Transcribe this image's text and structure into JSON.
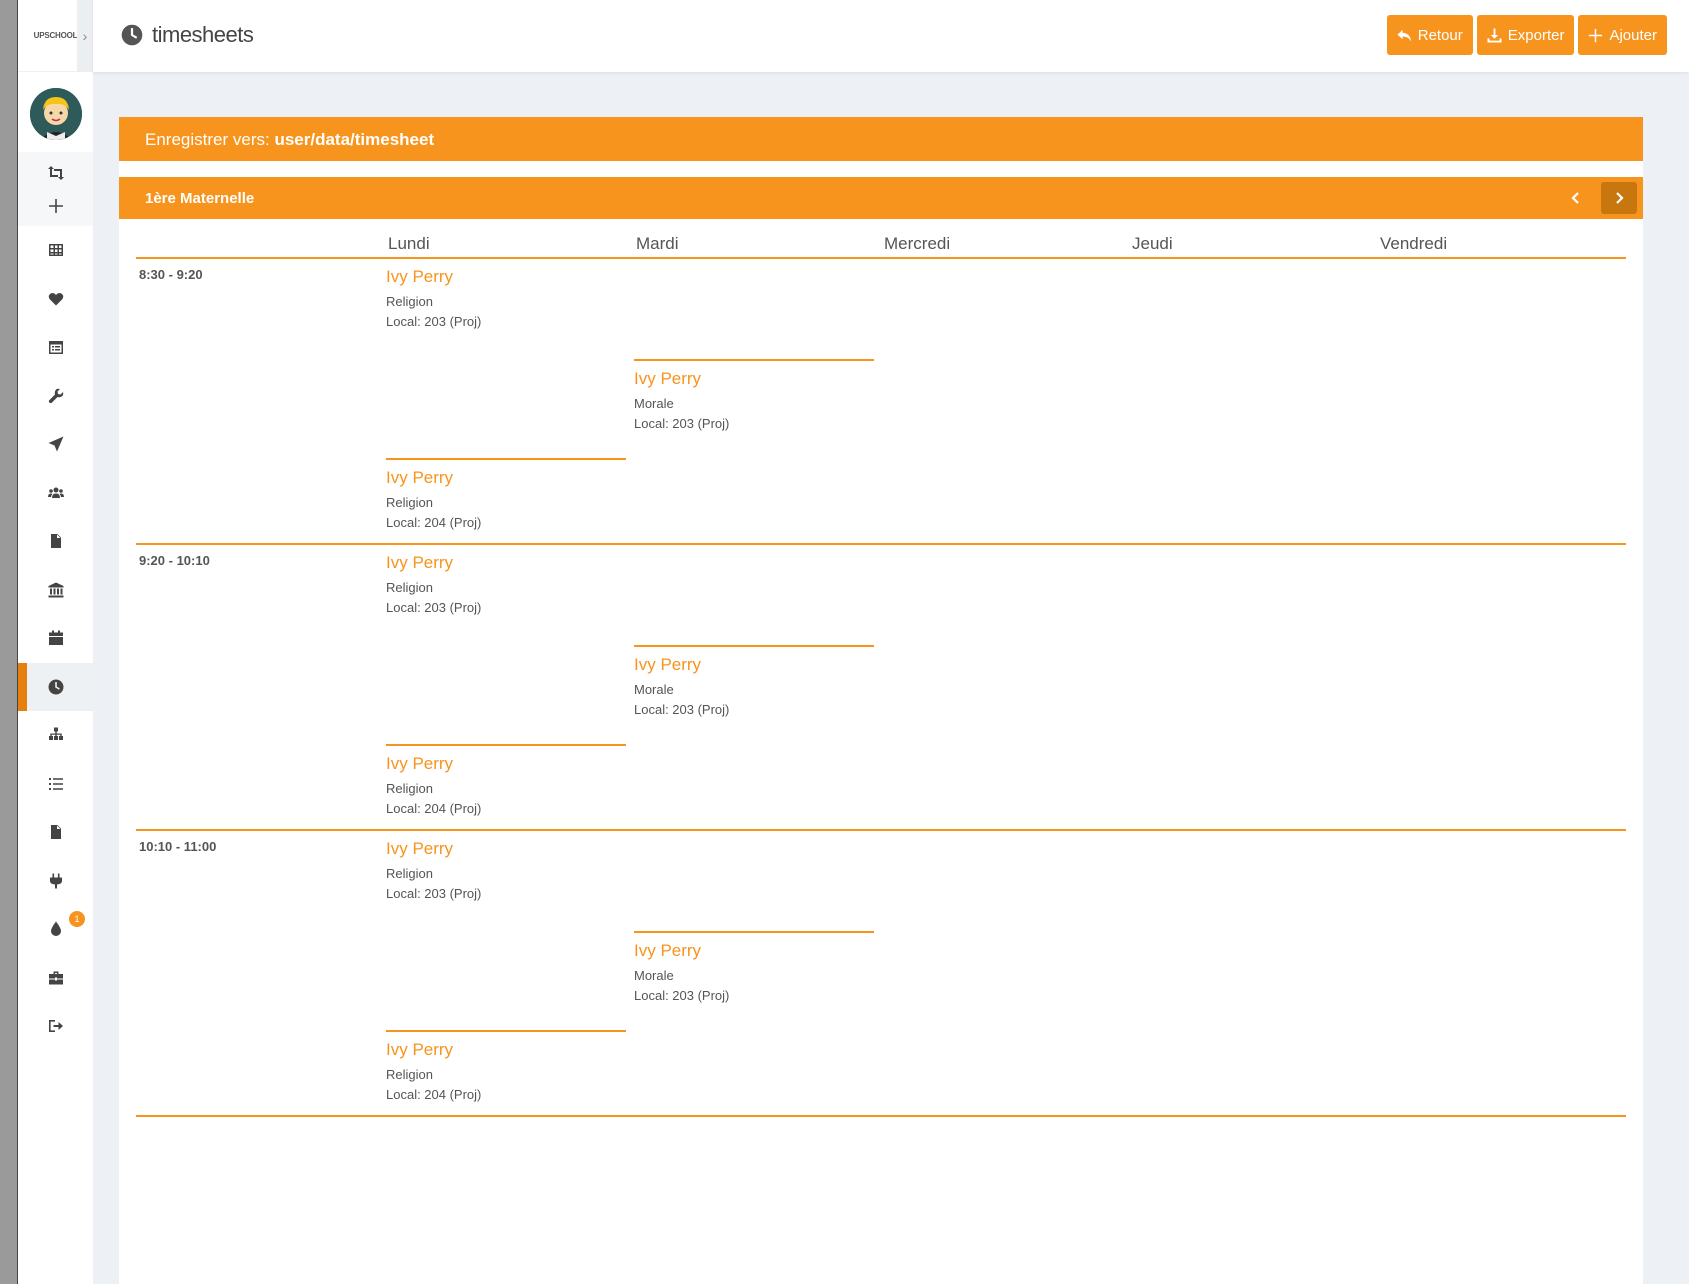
{
  "app": {
    "logo_text": "UPSCHOOL",
    "page_title": "timesheets"
  },
  "toolbar": {
    "back_label": "Retour",
    "export_label": "Exporter",
    "add_label": "Ajouter"
  },
  "save": {
    "prefix": "Enregistrer vers:",
    "path": "user/data/timesheet"
  },
  "sidebar": {
    "badge_count": "1",
    "items": [
      {
        "name": "sidebar-item-switch",
        "icon": "switch-icon"
      },
      {
        "name": "sidebar-item-add",
        "icon": "plus-icon"
      },
      {
        "name": "sidebar-item-grid",
        "icon": "table-icon"
      },
      {
        "name": "sidebar-item-favorites",
        "icon": "heart-icon"
      },
      {
        "name": "sidebar-item-calendar-list",
        "icon": "calendar-list-icon"
      },
      {
        "name": "sidebar-item-tools",
        "icon": "wrench-icon"
      },
      {
        "name": "sidebar-item-send",
        "icon": "paper-plane-icon"
      },
      {
        "name": "sidebar-item-users",
        "icon": "users-icon"
      },
      {
        "name": "sidebar-item-documents",
        "icon": "file-icon"
      },
      {
        "name": "sidebar-item-institution",
        "icon": "bank-icon"
      },
      {
        "name": "sidebar-item-calendar",
        "icon": "calendar-icon"
      },
      {
        "name": "sidebar-item-timesheets",
        "icon": "clock-icon"
      },
      {
        "name": "sidebar-item-hierarchy",
        "icon": "sitemap-icon"
      },
      {
        "name": "sidebar-item-list",
        "icon": "list-icon"
      },
      {
        "name": "sidebar-item-reports",
        "icon": "file-text-icon"
      },
      {
        "name": "sidebar-item-plugins",
        "icon": "plug-icon"
      },
      {
        "name": "sidebar-item-theme",
        "icon": "drop-icon"
      },
      {
        "name": "sidebar-item-briefcase",
        "icon": "briefcase-icon"
      },
      {
        "name": "sidebar-item-logout",
        "icon": "sign-out-icon"
      }
    ]
  },
  "timetable": {
    "class_name": "1ère Maternelle",
    "days": [
      "Lundi",
      "Mardi",
      "Mercredi",
      "Jeudi",
      "Vendredi"
    ],
    "slots": [
      {
        "time": "8:30 - 9:20",
        "entries": [
          {
            "teacher": "Ivy Perry",
            "subject": "Religion",
            "room": "Local: 203 (Proj)"
          },
          {
            "teacher": "Ivy Perry",
            "subject": "Morale",
            "room": "Local: 203 (Proj)"
          },
          {
            "teacher": "Ivy Perry",
            "subject": "Religion",
            "room": "Local: 204 (Proj)"
          }
        ]
      },
      {
        "time": "9:20 - 10:10",
        "entries": [
          {
            "teacher": "Ivy Perry",
            "subject": "Religion",
            "room": "Local: 203 (Proj)"
          },
          {
            "teacher": "Ivy Perry",
            "subject": "Morale",
            "room": "Local: 203 (Proj)"
          },
          {
            "teacher": "Ivy Perry",
            "subject": "Religion",
            "room": "Local: 204 (Proj)"
          }
        ]
      },
      {
        "time": "10:10 - 11:00",
        "entries": [
          {
            "teacher": "Ivy Perry",
            "subject": "Religion",
            "room": "Local: 203 (Proj)"
          },
          {
            "teacher": "Ivy Perry",
            "subject": "Morale",
            "room": "Local: 203 (Proj)"
          },
          {
            "teacher": "Ivy Perry",
            "subject": "Religion",
            "room": "Local: 204 (Proj)"
          }
        ]
      }
    ]
  },
  "colors": {
    "accent": "#f7941d",
    "accent_dark": "#c8770f",
    "active_marker": "#e5800f",
    "background": "#edf1f5"
  }
}
